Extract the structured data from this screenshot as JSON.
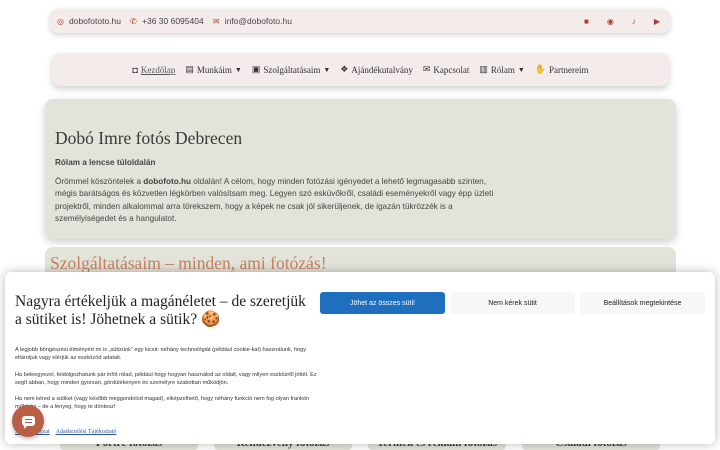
{
  "topbar": {
    "web": "dobofototo.hu",
    "phone": "+36 30 6095404",
    "email": "info@dobofoto.hu",
    "social_icons": [
      "facebook-icon",
      "instagram-icon",
      "tiktok-icon",
      "youtube-icon"
    ]
  },
  "nav": {
    "items": [
      {
        "label": "Kezdőlap",
        "icon": "camera-icon"
      },
      {
        "label": "Munkáim",
        "icon": "images-icon"
      },
      {
        "label": "Szolgáltatásaim",
        "icon": "photo-icon"
      },
      {
        "label": "Ajándékutalvány",
        "icon": "gift-icon"
      },
      {
        "label": "Kapcsolat",
        "icon": "envelope-icon"
      },
      {
        "label": "Rólam",
        "icon": "id-card-icon"
      },
      {
        "label": "Partnereim",
        "icon": "handshake-icon"
      }
    ]
  },
  "hero": {
    "title": "Dobó Imre fotós Debrecen",
    "subtitle": "Rólam a lencse túloldalán",
    "para_pre": "Örömmel köszöntelek a ",
    "para_bold": "dobofoto.hu",
    "para_post": " oldalán! A célom, hogy minden fotózási igényedet a lehető legmagasabb szinten, mégis barátságos és közvetlen légkörben valósítsam meg. Legyen szó esküvőkről, családi eseményekről vagy épp üzleti projektről, minden alkalommal arra törekszem, hogy a képek ne csak jól sikerüljenek, de igazán tükrözzék is a személyiségedet és a hangulatot."
  },
  "services": {
    "title": "Szolgáltatásaim – minden, ami fotózás!",
    "cards": [
      "Portré fotózás",
      "Rendezvény fotózás",
      "Termék és reklám fotózás",
      "Családi fotózás"
    ]
  },
  "cookie": {
    "title": "Nagyra értékeljük a magánéletet – de szeretjük a sütiket is! Jöhetnek a sütik? 🍪",
    "text1": "A legjobb böngészési élményért mi is „sütizünk” egy kicsit: néhány technológiát (például cookie-kat) használunk, hogy eltároljuk vagy elérjük az eszközöd adatait.",
    "text2": "Ha beleegyezel, feldolgozhatunk pár infót rólad, például hogy hogyan használod az oldalt, vagy milyen eszközről jöttél. Ez segít abban, hogy minden gyorsan, gördülékenyen és személyre szabottan működjön.",
    "text3": "Ha nem kéred a sütiket (vagy később meggondolod magad), elképzelhető, hogy néhány funkció nem fog olyan frankón működni – de a lényeg, hogy te döntesz!",
    "link1": "Sütiszabályzat",
    "link2": "Adatkezelési Tájékoztató",
    "btn_accept": "Jöhet az összes süti!",
    "btn_deny": "Nem kérek sütit",
    "btn_settings": "Beállítások megtekintése"
  }
}
